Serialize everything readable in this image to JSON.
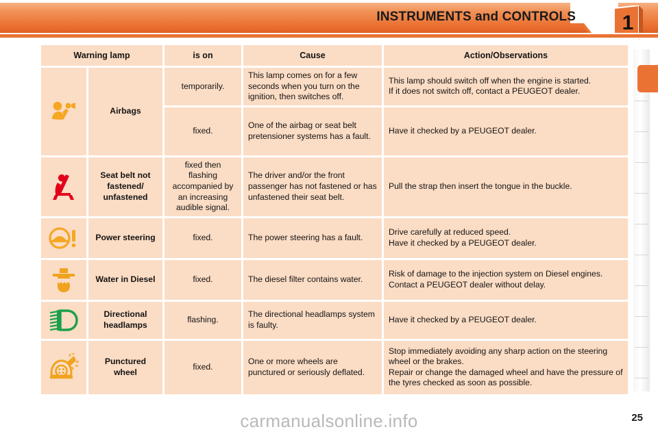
{
  "header": {
    "title": "INSTRUMENTS and CONTROLS",
    "chapter_number": "1",
    "accent_color": "#ea7334"
  },
  "table": {
    "columns": [
      "Warning lamp",
      "is on",
      "Cause",
      "Action/Observations"
    ],
    "rows": [
      {
        "icon": "airbag-warning-icon",
        "icon_color": "#f5a623",
        "name": "Airbags",
        "states": [
          {
            "is_on": "temporarily.",
            "cause": "This lamp comes on for a few seconds when you turn on the ignition, then switches off.",
            "action_lines": [
              "This lamp should switch off when the engine is started.",
              "If it does not switch off, contact a PEUGEOT dealer."
            ]
          },
          {
            "is_on": "fixed.",
            "cause": "One of the airbag or seat belt pretensioner systems has a fault.",
            "action_lines": [
              "Have it checked by a PEUGEOT dealer."
            ]
          }
        ]
      },
      {
        "icon": "seatbelt-unfastened-icon",
        "icon_color": "#e2001a",
        "name": "Seat belt not fastened/ unfastened",
        "states": [
          {
            "is_on": "fixed then flashing accompanied by an increasing audible signal.",
            "cause": "The driver and/or the front passenger has not fastened or has unfastened their seat belt.",
            "action_lines": [
              "Pull the strap then insert the tongue in the buckle."
            ]
          }
        ]
      },
      {
        "icon": "power-steering-icon",
        "icon_color": "#f5a623",
        "name": "Power steering",
        "states": [
          {
            "is_on": "fixed.",
            "cause": "The power steering has a fault.",
            "cause_justify": true,
            "action_lines": [
              "Drive carefully at reduced speed.",
              "Have it checked by a PEUGEOT dealer."
            ]
          }
        ]
      },
      {
        "icon": "water-in-diesel-icon",
        "icon_color": "#f0a31e",
        "name": "Water in Diesel",
        "states": [
          {
            "is_on": "fixed.",
            "cause": "The diesel filter contains water.",
            "action_lines": [
              "Risk of damage to the injection system on Diesel engines.",
              "Contact a PEUGEOT dealer without delay."
            ]
          }
        ]
      },
      {
        "icon": "directional-headlamps-icon",
        "icon_color": "#1aa04b",
        "name": "Directional headlamps",
        "states": [
          {
            "is_on": "flashing.",
            "cause": "The directional headlamps system is faulty.",
            "action_lines": [
              "Have it checked by a PEUGEOT dealer."
            ]
          }
        ]
      },
      {
        "icon": "punctured-wheel-icon",
        "icon_color": "#f0a31e",
        "name": "Punctured wheel",
        "states": [
          {
            "is_on": "fixed.",
            "cause": "One or more wheels are punctured or seriously deflated.",
            "action_lines": [
              "Stop immediately avoiding any sharp action on the steering wheel or the brakes.",
              "Repair or change the damaged wheel and have the pressure of the tyres checked as soon as possible."
            ]
          }
        ]
      }
    ]
  },
  "footer": {
    "page_number": "25",
    "watermark": "carmanualsonline.info"
  }
}
